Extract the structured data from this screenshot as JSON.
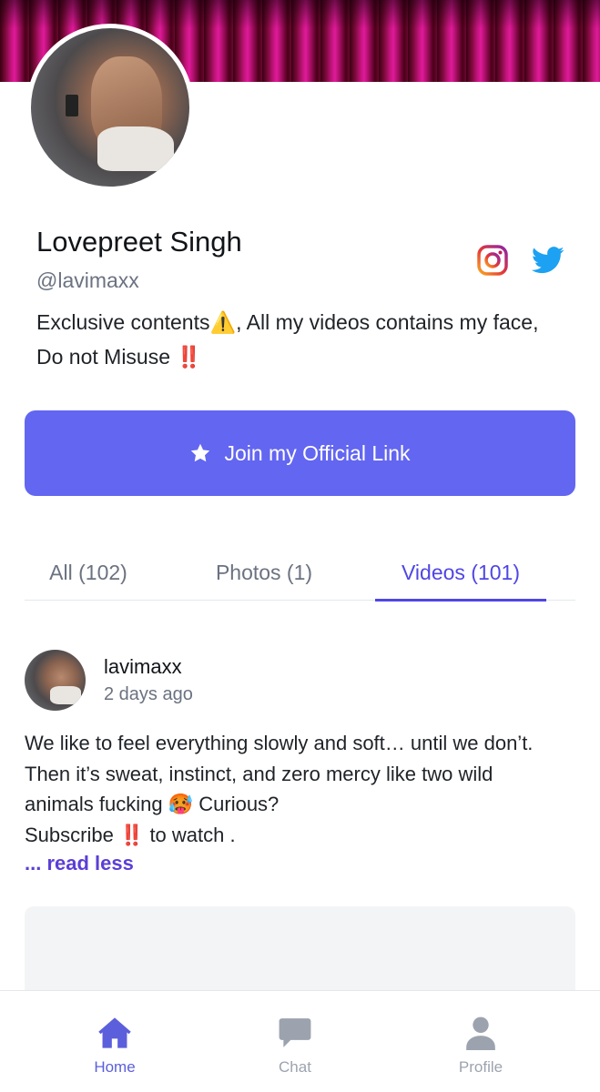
{
  "profile": {
    "name": "Lovepreet Singh",
    "handle": "@lavimaxx",
    "bio": "Exclusive contents⚠️, All my videos contains my face, Do not Misuse ‼️"
  },
  "social": {
    "instagram_icon": "instagram-icon",
    "twitter_icon": "twitter-icon"
  },
  "cta": {
    "label": "Join my Official Link",
    "color": "#6366f1"
  },
  "tabs": [
    {
      "label": "All (102)",
      "active": false
    },
    {
      "label": "Photos (1)",
      "active": false
    },
    {
      "label": "Videos (101)",
      "active": true
    }
  ],
  "post": {
    "username": "lavimaxx",
    "time": "2 days ago",
    "text_line1": "We like to feel everything slowly and soft… until we don’t.",
    "text_line2": "Then it’s sweat, instinct, and zero mercy like two wild",
    "text_line3": "animals fucking 🥵 Curious?",
    "text_line4": "Subscribe ‼️ to watch .",
    "read_less": "... read less"
  },
  "nav": [
    {
      "label": "Home",
      "active": true
    },
    {
      "label": "Chat",
      "active": false
    },
    {
      "label": "Profile",
      "active": false
    }
  ],
  "colors": {
    "accent": "#6366f1",
    "tab_active": "#4f46e5",
    "read_less": "#5b3fd6"
  }
}
